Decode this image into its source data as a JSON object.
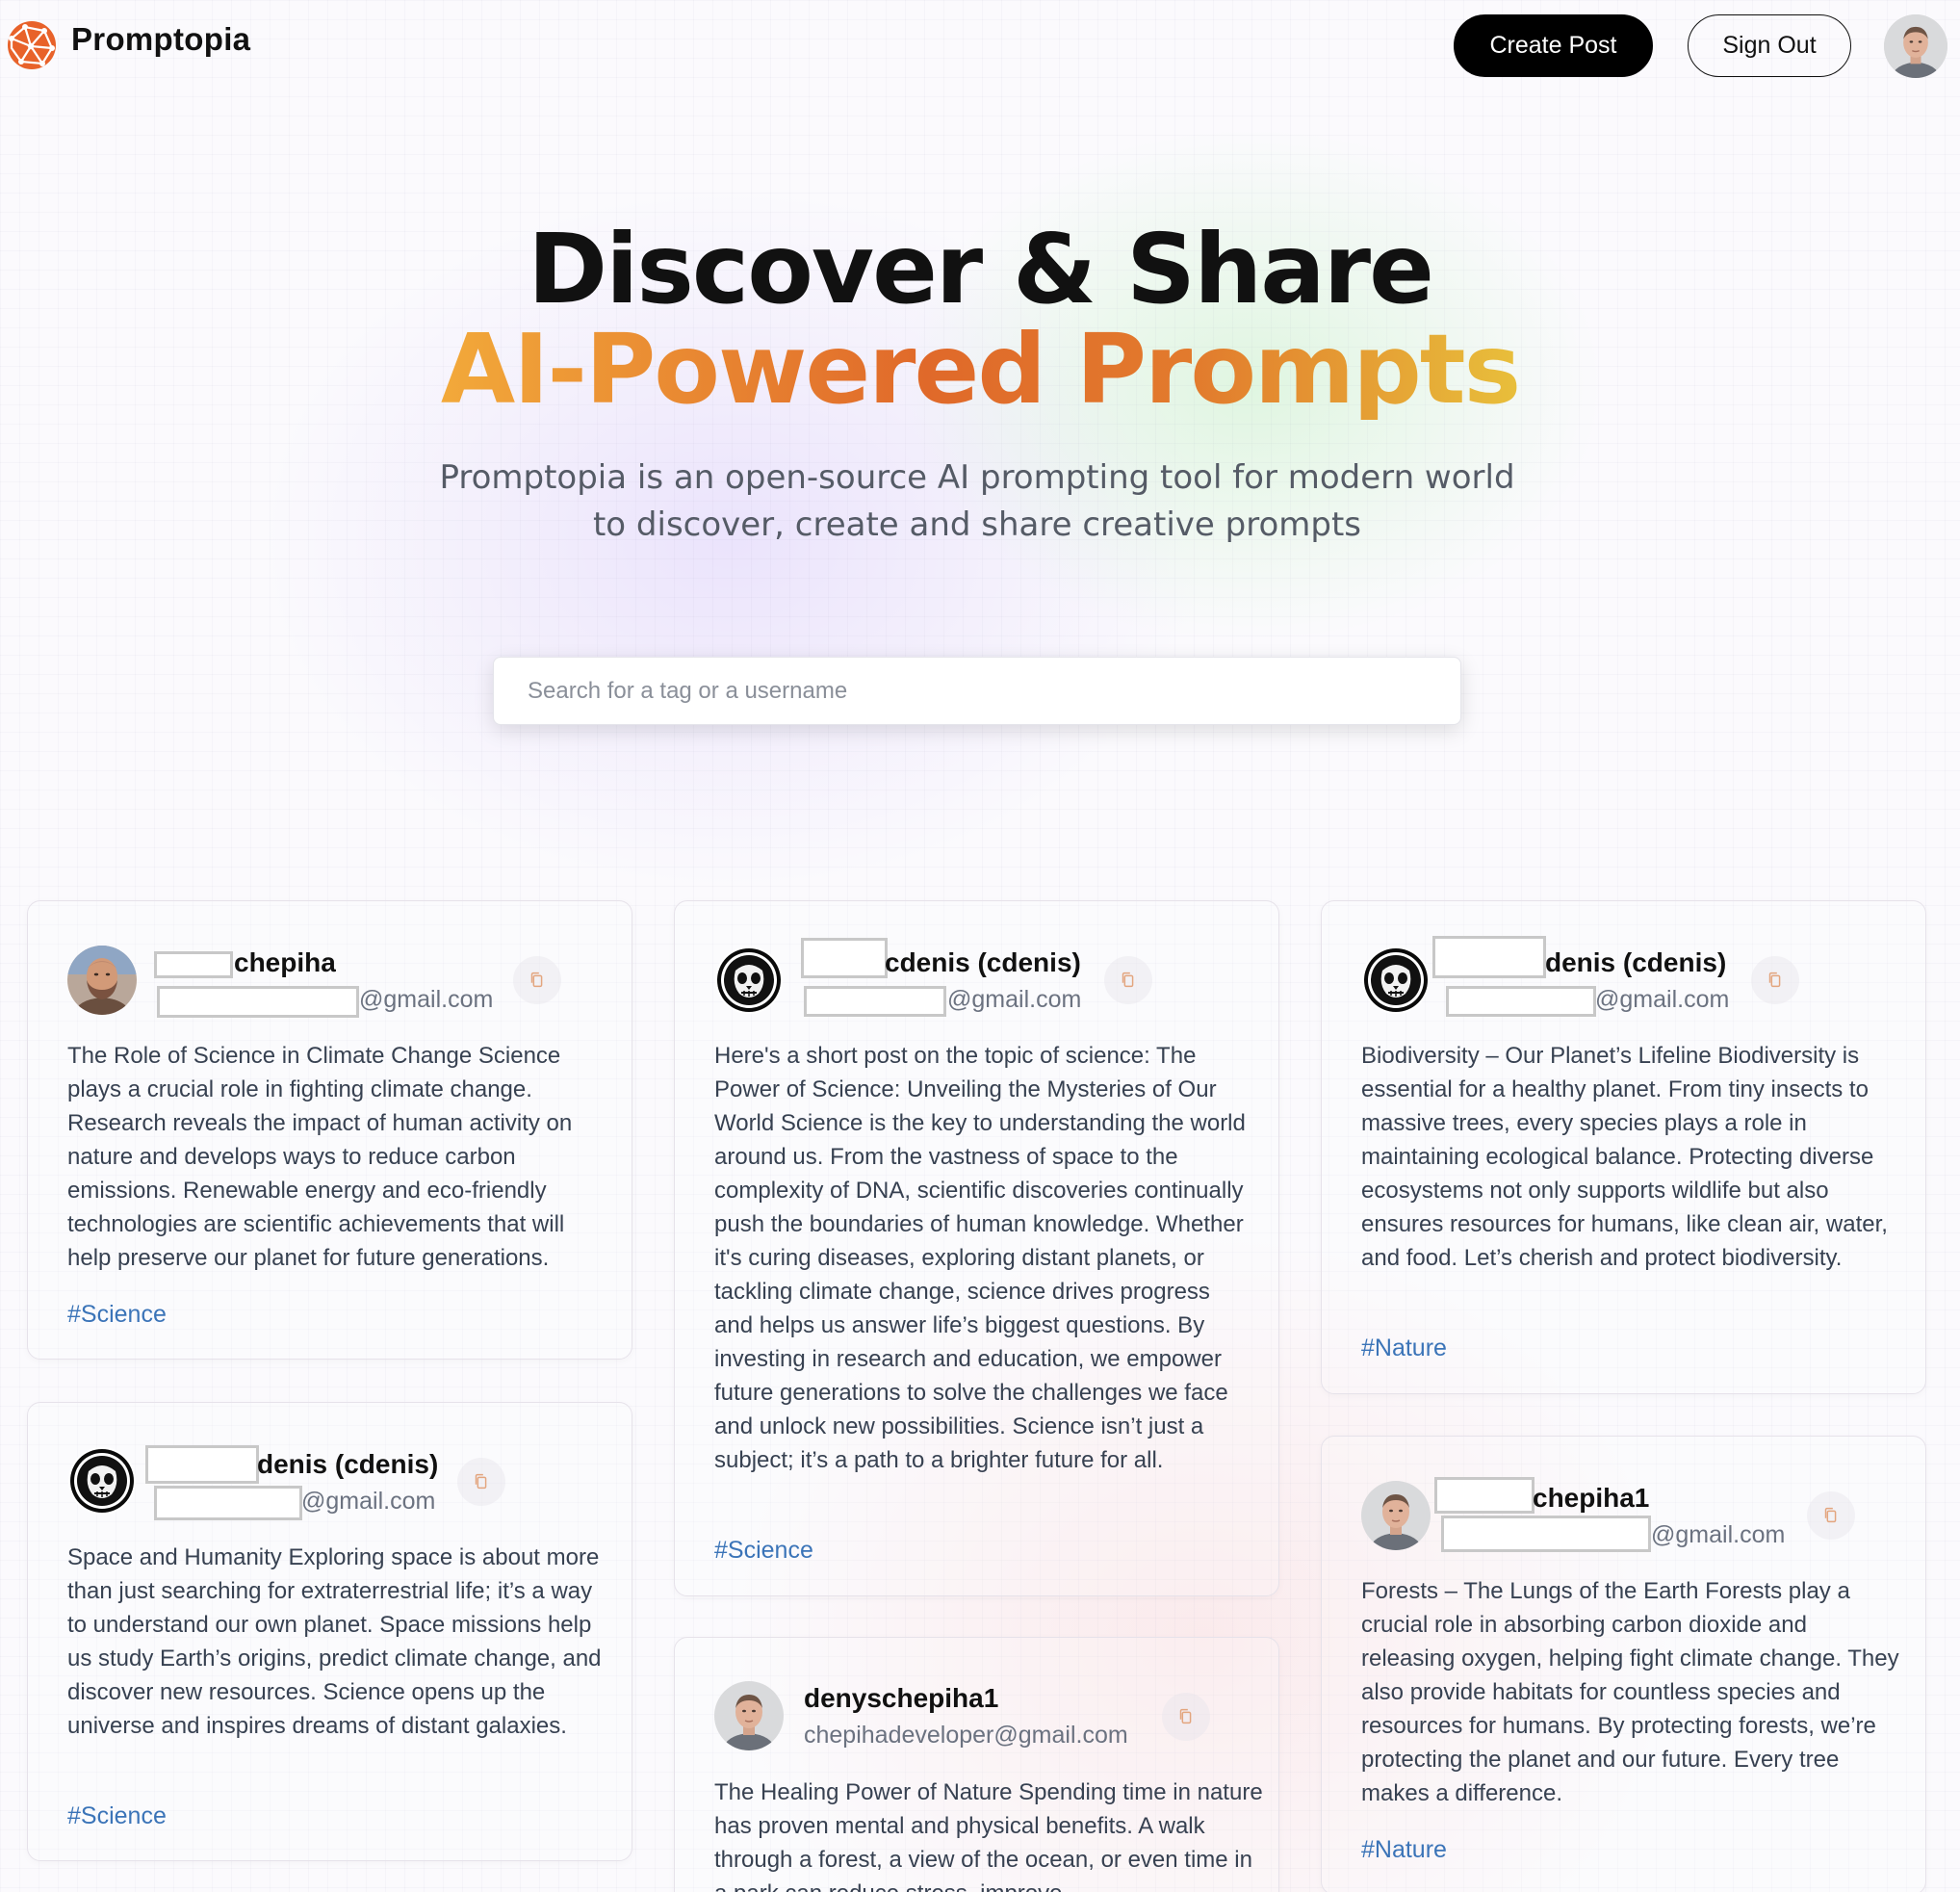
{
  "nav": {
    "brand": "Promptopia",
    "create_label": "Create Post",
    "signout_label": "Sign Out"
  },
  "hero": {
    "title_line1": "Discover & Share",
    "title_line2": "AI-Powered Prompts",
    "description": "Promptopia is an open-source AI prompting tool for modern world to discover, create and share creative prompts"
  },
  "search": {
    "placeholder": "Search for a tag or a username"
  },
  "colors": {
    "accent_orange": "#e0692a",
    "tag_blue": "#3b74b8"
  },
  "posts": [
    {
      "username": "chepiha",
      "email": "@gmail.com",
      "avatar": "avatar-photo-bearded",
      "text": "The Role of Science in Climate Change Science plays a crucial role in fighting climate change. Research reveals the impact of human activity on nature and develops ways to reduce carbon emissions. Renewable energy and eco-friendly technologies are scientific achievements that will help preserve our planet for future generations.",
      "tag": "#Science"
    },
    {
      "username": "denis (cdenis)",
      "email": "@gmail.com",
      "avatar": "avatar-ghost-mask",
      "text": "Space and Humanity Exploring space is about more than just searching for extraterrestrial life; it’s a way to understand our own planet. Space missions help us study Earth’s origins, predict climate change, and discover new resources. Science opens up the universe and inspires dreams of distant galaxies.",
      "tag": "#Science"
    },
    {
      "username": "cdenis (cdenis)",
      "email": "@gmail.com",
      "avatar": "avatar-ghost-mask",
      "text": "Here's a short post on the topic of science: The Power of Science: Unveiling the Mysteries of Our World Science is the key to understanding the world around us. From the vastness of space to the complexity of DNA, scientific discoveries continually push the boundaries of human knowledge. Whether it's curing diseases, exploring distant planets, or tackling climate change, science drives progress and helps us answer life’s biggest questions. By investing in research and education, we empower future generations to solve the challenges we face and unlock new possibilities. Science isn’t just a subject; it’s a path to a brighter future for all.",
      "tag": "#Science"
    },
    {
      "username": "denyschepiha1",
      "email": "chepihadeveloper@gmail.com",
      "avatar": "avatar-photo-man",
      "text": "The Healing Power of Nature Spending time in nature has proven mental and physical benefits. A walk through a forest, a view of the ocean, or even time in a park can reduce stress, improve",
      "tag": ""
    },
    {
      "username": "denis (cdenis)",
      "email": "@gmail.com",
      "avatar": "avatar-ghost-mask",
      "text": "Biodiversity – Our Planet’s Lifeline Biodiversity is essential for a healthy planet. From tiny insects to massive trees, every species plays a role in maintaining ecological balance. Protecting diverse ecosystems not only supports wildlife but also ensures resources for humans, like clean air, water, and food. Let’s cherish and protect biodiversity.",
      "tag": "#Nature"
    },
    {
      "username": "chepiha1",
      "email": "@gmail.com",
      "avatar": "avatar-photo-man",
      "text": "Forests – The Lungs of the Earth Forests play a crucial role in absorbing carbon dioxide and releasing oxygen, helping fight climate change. They also provide habitats for countless species and resources for humans. By protecting forests, we’re protecting the planet and our future. Every tree makes a difference.",
      "tag": "#Nature"
    }
  ]
}
